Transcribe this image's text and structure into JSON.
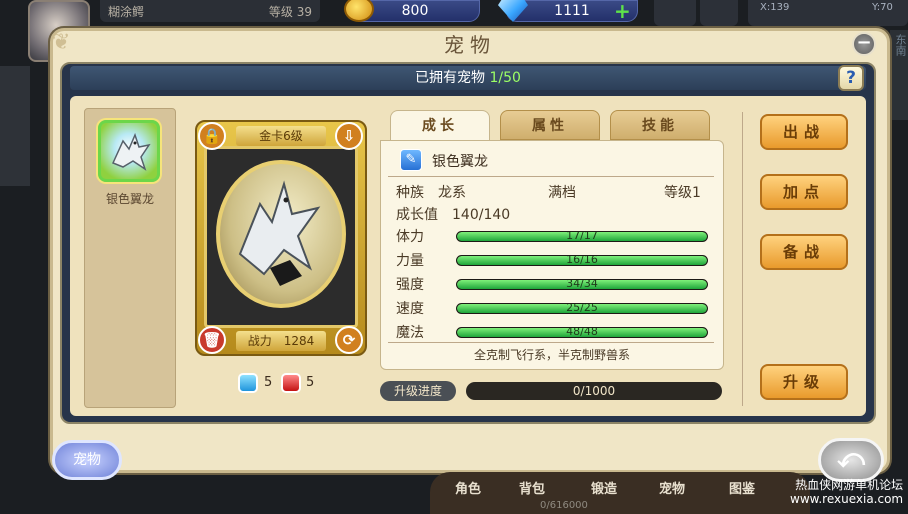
{
  "hud": {
    "player_name": "糊涂鳄",
    "level_label": "等级 39",
    "gold": "800",
    "diamonds": "1111",
    "coord_x": "X:139",
    "coord_y": "Y:70",
    "edge_text": "东南"
  },
  "window": {
    "title": "宠物",
    "owned_label": "已拥有宠物",
    "owned_count": "1/50",
    "help": "?"
  },
  "pet_list": [
    {
      "name": "银色翼龙"
    }
  ],
  "card": {
    "title": "金卡6级",
    "power": "战力　1284",
    "blue_stones": "5",
    "red_stones": "5"
  },
  "tabs": [
    {
      "label": "成长",
      "active": true
    },
    {
      "label": "属性",
      "active": false
    },
    {
      "label": "技能",
      "active": false
    }
  ],
  "pet": {
    "name": "银色翼龙",
    "race": "种族　龙系",
    "full": "满档",
    "level": "等级1",
    "growth": "成长值　140/140",
    "stats": [
      {
        "label": "体力",
        "text": "17/17",
        "value": 17,
        "max": 17
      },
      {
        "label": "力量",
        "text": "16/16",
        "value": 16,
        "max": 16
      },
      {
        "label": "强度",
        "text": "34/34",
        "value": 34,
        "max": 34
      },
      {
        "label": "速度",
        "text": "25/25",
        "value": 25,
        "max": 25
      },
      {
        "label": "魔法",
        "text": "48/48",
        "value": 48,
        "max": 48
      }
    ],
    "desc": "全克制飞行系，半克制野兽系"
  },
  "upgrade": {
    "label": "升级进度",
    "progress": "0/1000",
    "fraction": 0
  },
  "actions": {
    "fight": "出战",
    "add_points": "加点",
    "standby": "备战",
    "upgrade": "升级"
  },
  "bottom": {
    "pet_button": "宠物",
    "dock": [
      "角色",
      "背包",
      "锻造",
      "宠物",
      "图鉴"
    ],
    "dock_sub": "0/616000",
    "watermark_1": "热血侠网游单机论坛",
    "watermark_2": "www.rexuexia.com"
  }
}
